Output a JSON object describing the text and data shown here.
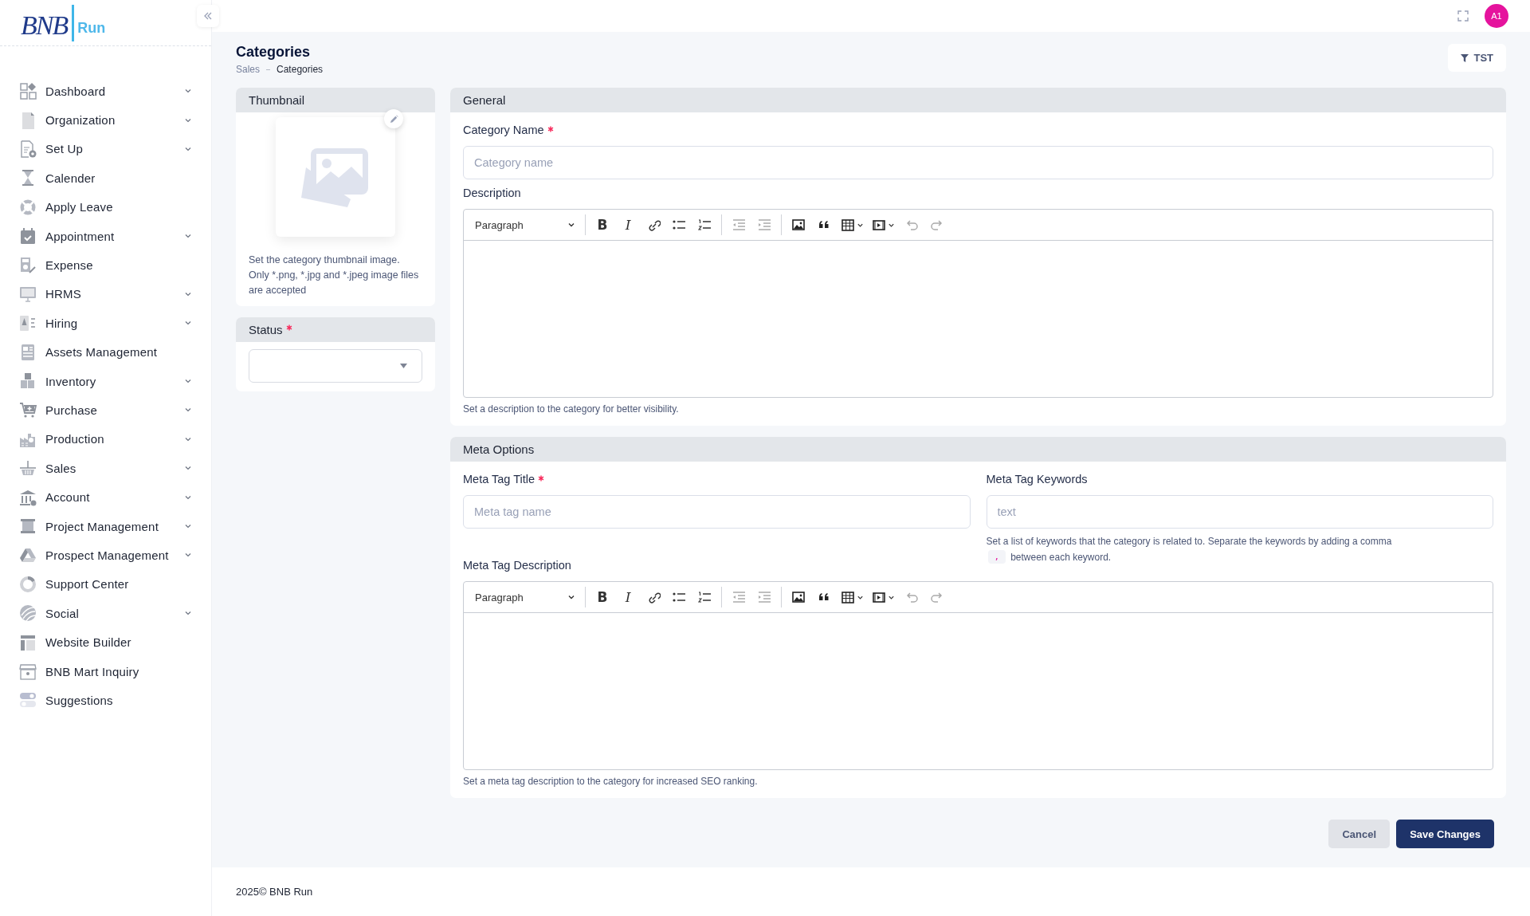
{
  "logo": {
    "mark": "BNB",
    "word": "Run"
  },
  "sidebar": {
    "items": [
      {
        "label": "Dashboard",
        "expandable": true
      },
      {
        "label": "Organization",
        "expandable": true
      },
      {
        "label": "Set Up",
        "expandable": true
      },
      {
        "label": "Calender",
        "expandable": false
      },
      {
        "label": "Apply Leave",
        "expandable": false
      },
      {
        "label": "Appointment",
        "expandable": true
      },
      {
        "label": "Expense",
        "expandable": false
      },
      {
        "label": "HRMS",
        "expandable": true
      },
      {
        "label": "Hiring",
        "expandable": true
      },
      {
        "label": "Assets Management",
        "expandable": false
      },
      {
        "label": "Inventory",
        "expandable": true
      },
      {
        "label": "Purchase",
        "expandable": true
      },
      {
        "label": "Production",
        "expandable": true
      },
      {
        "label": "Sales",
        "expandable": true
      },
      {
        "label": "Account",
        "expandable": true
      },
      {
        "label": "Project Management",
        "expandable": true
      },
      {
        "label": "Prospect Management",
        "expandable": true
      },
      {
        "label": "Support Center",
        "expandable": false
      },
      {
        "label": "Social",
        "expandable": true
      },
      {
        "label": "Website Builder",
        "expandable": false
      },
      {
        "label": "BNB Mart Inquiry",
        "expandable": false
      },
      {
        "label": "Suggestions",
        "expandable": false
      }
    ]
  },
  "header": {
    "avatar": "A1"
  },
  "page": {
    "title": "Categories",
    "breadcrumb": [
      "Sales",
      "Categories"
    ],
    "filter_button": "TST"
  },
  "thumbnail": {
    "title": "Thumbnail",
    "hint": "Set the category thumbnail image. Only *.png, *.jpg and *.jpeg image files are accepted"
  },
  "status": {
    "title": "Status",
    "required": true
  },
  "general": {
    "title": "General",
    "name_field": {
      "label": "Category Name",
      "required": true,
      "placeholder": "Category name"
    },
    "description": {
      "label": "Description",
      "editor": {
        "block_format": "Paragraph",
        "glyphs": [
          "B",
          "I"
        ]
      },
      "hint": "Set a description to the category for better visibility."
    }
  },
  "meta": {
    "title": "Meta Options",
    "title_field": {
      "label": "Meta Tag Title",
      "required": true,
      "placeholder": "Meta tag name"
    },
    "keywords_field": {
      "label": "Meta Tag Keywords",
      "required": false,
      "placeholder": "text",
      "hint": "Set a list of keywords that the category is related to. Separate the keywords by adding a comma",
      "hint_code": ",",
      "hint_end": "between each keyword."
    },
    "description": {
      "label": "Meta Tag Description",
      "editor": {
        "block_format": "Paragraph",
        "glyphs": [
          "B",
          "I"
        ]
      },
      "hint": "Set a meta tag description to the category for increased SEO ranking."
    }
  },
  "actions": {
    "cancel": "Cancel",
    "save": "Save Changes"
  },
  "footer": "2025© BNB Run"
}
